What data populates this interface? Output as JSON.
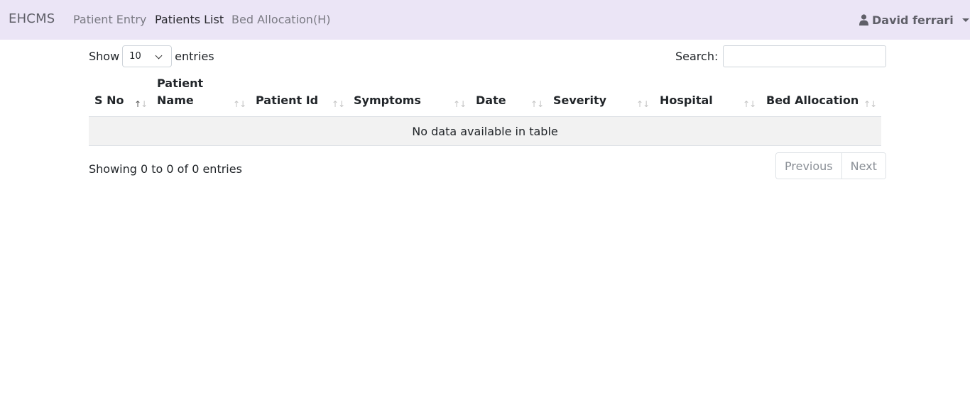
{
  "nav": {
    "brand": "EHCMS",
    "links": [
      "Patient Entry",
      "Patients List",
      "Bed Allocation(H)"
    ],
    "user": "David ferrari"
  },
  "table_controls": {
    "show_label": "Show",
    "page_size": "10",
    "entries_label": "entries",
    "search_label": "Search:",
    "search_value": ""
  },
  "table": {
    "columns": [
      {
        "line1": "S No",
        "line2": ""
      },
      {
        "line1": "Patient",
        "line2": "Name"
      },
      {
        "line1": "Patient Id",
        "line2": ""
      },
      {
        "line1": "Symptoms",
        "line2": ""
      },
      {
        "line1": "Date",
        "line2": ""
      },
      {
        "line1": "Severity",
        "line2": ""
      },
      {
        "line1": "Hospital",
        "line2": ""
      },
      {
        "line1": "Bed Allocation",
        "line2": ""
      }
    ],
    "empty_message": "No data available in table",
    "sort_up": "↑",
    "sort_down": "↓"
  },
  "footer": {
    "info": "Showing 0 to 0 of 0 entries",
    "prev": "Previous",
    "next": "Next"
  },
  "icons": {
    "user": "user-icon",
    "dropdown": "caret-down-icon",
    "select": "chevron-down-icon",
    "sort": "sort-icon"
  }
}
